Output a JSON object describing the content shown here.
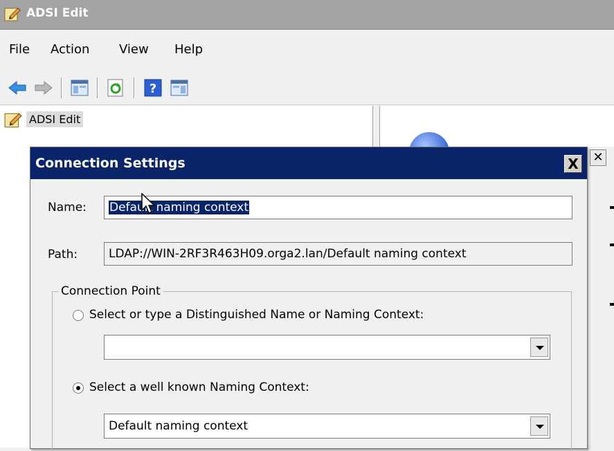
{
  "window": {
    "title": "ADSI Edit"
  },
  "menu": [
    "File",
    "Action",
    "View",
    "Help"
  ],
  "toolbar": {
    "buttons": [
      "back-icon",
      "forward-icon",
      "show-hide-console-tree-icon",
      "refresh-icon",
      "help-icon",
      "show-hide-action-pane-icon"
    ]
  },
  "tree": {
    "root_label": "ADSI Edit"
  },
  "dialog": {
    "title": "Connection Settings",
    "close_label": "X",
    "name_label": "Name:",
    "name_value": "Default naming context",
    "path_label": "Path:",
    "path_value": "LDAP://WIN-2RF3R463H09.orga2.lan/Default naming context",
    "group_label": "Connection Point",
    "option1_label": "Select or type a Distinguished Name or Naming Context:",
    "option1_value": "",
    "option2_label": "Select a well known Naming Context:",
    "option2_value": "Default naming context",
    "selected_option": "option2"
  },
  "colors": {
    "dialog_title_bg": "#0a246a",
    "selection_bg": "#0a246a",
    "window_title_bg": "#a3a3a3"
  }
}
